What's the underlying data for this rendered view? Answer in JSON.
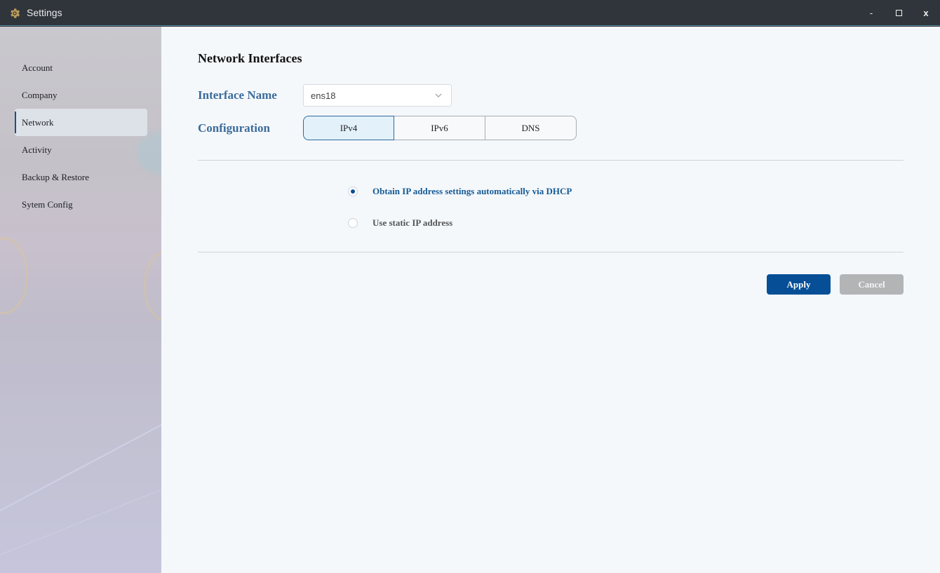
{
  "window": {
    "title": "Settings",
    "minimize_label": "-",
    "close_label": "x",
    "app_icon": "gear-icon"
  },
  "sidebar": {
    "items": [
      {
        "label": "Account",
        "active": false
      },
      {
        "label": "Company",
        "active": false
      },
      {
        "label": "Network",
        "active": true
      },
      {
        "label": "Activity",
        "active": false
      },
      {
        "label": "Backup & Restore",
        "active": false
      },
      {
        "label": "Sytem Config",
        "active": false
      }
    ]
  },
  "main": {
    "heading": "Network Interfaces",
    "interface_label": "Interface Name",
    "interface_value": "ens18",
    "config_label": "Configuration",
    "tabs": [
      {
        "label": "IPv4",
        "active": true
      },
      {
        "label": "IPv6",
        "active": false
      },
      {
        "label": "DNS",
        "active": false
      }
    ],
    "options": [
      {
        "label": "Obtain IP address settings automatically via DHCP",
        "checked": true
      },
      {
        "label": "Use static IP address",
        "checked": false
      }
    ],
    "apply_label": "Apply",
    "cancel_label": "Cancel"
  },
  "colors": {
    "accent": "#064f97",
    "label": "#3c6b9a",
    "titlebar": "#2f353b"
  }
}
